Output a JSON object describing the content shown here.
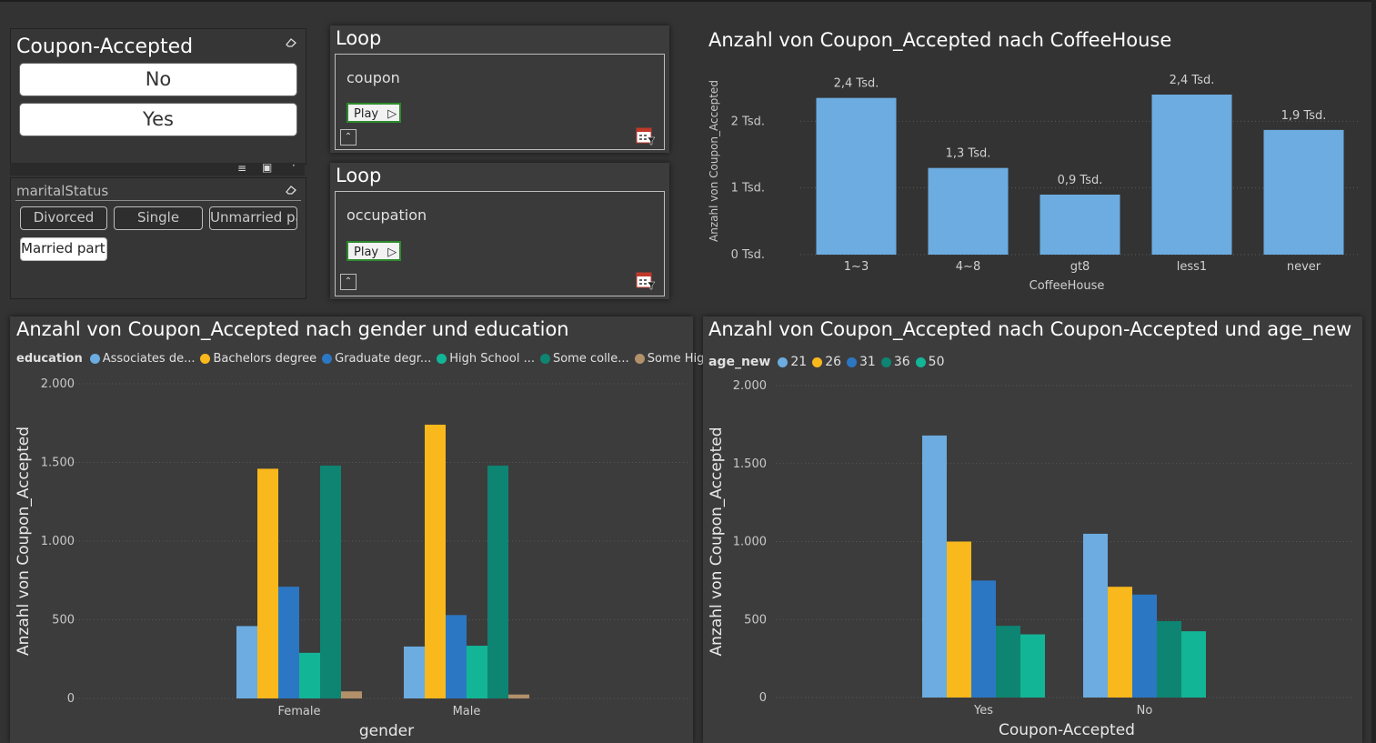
{
  "coupon_slicer": {
    "title": "Coupon-Accepted",
    "options": [
      "No",
      "Yes"
    ]
  },
  "marital_slicer": {
    "title": "maritalStatus",
    "options": [
      "Divorced",
      "Single",
      "Unmarried pa",
      "Married partn"
    ]
  },
  "loops": [
    {
      "title": "Loop",
      "field": "coupon",
      "play_label": "Play"
    },
    {
      "title": "Loop",
      "field": "occupation",
      "play_label": "Play"
    }
  ],
  "chart_data": [
    {
      "type": "bar",
      "title": "Anzahl von Coupon_Accepted nach CoffeeHouse",
      "xlabel": "CoffeeHouse",
      "ylabel": "Anzahl von Coupon_Accepted",
      "categories": [
        "1~3",
        "4~8",
        "gt8",
        "less1",
        "never"
      ],
      "values": [
        2.35,
        1.3,
        0.9,
        2.4,
        1.87
      ],
      "data_labels": [
        "2,4 Tsd.",
        "1,3 Tsd.",
        "0,9 Tsd.",
        "2,4 Tsd.",
        "1,9 Tsd."
      ],
      "yticks": [
        "0 Tsd.",
        "1 Tsd.",
        "2 Tsd."
      ],
      "ylim": [
        0,
        2.4
      ],
      "color": "#6cace0"
    },
    {
      "type": "bar",
      "title": "Anzahl von Coupon_Accepted nach gender und education",
      "xlabel": "gender",
      "ylabel": "Anzahl von Coupon_Accepted",
      "legend_title": "education",
      "categories": [
        "Female",
        "Male"
      ],
      "series": [
        {
          "name": "Associates de...",
          "color": "#6cace0",
          "values": [
            460,
            330
          ]
        },
        {
          "name": "Bachelors degree",
          "color": "#f9b81c",
          "values": [
            1460,
            1740
          ]
        },
        {
          "name": "Graduate degr...",
          "color": "#2c77c4",
          "values": [
            710,
            530
          ]
        },
        {
          "name": "High School ...",
          "color": "#13b597",
          "values": [
            290,
            335
          ]
        },
        {
          "name": "Some colle...",
          "color": "#0e8472",
          "values": [
            1480,
            1480
          ]
        },
        {
          "name": "Some High ...",
          "color": "#b2906a",
          "values": [
            45,
            25
          ]
        }
      ],
      "yticks": [
        "0",
        "500",
        "1.000",
        "1.500",
        "2.000"
      ],
      "ylim": [
        0,
        2000
      ]
    },
    {
      "type": "bar",
      "title": "Anzahl von Coupon_Accepted nach Coupon-Accepted und age_new",
      "xlabel": "Coupon-Accepted",
      "ylabel": "Anzahl von Coupon_Accepted",
      "legend_title": "age_new",
      "categories": [
        "Yes",
        "No"
      ],
      "series": [
        {
          "name": "21",
          "color": "#6cace0",
          "values": [
            1680,
            1050
          ]
        },
        {
          "name": "26",
          "color": "#f9b81c",
          "values": [
            1000,
            710
          ]
        },
        {
          "name": "31",
          "color": "#2c77c4",
          "values": [
            750,
            660
          ]
        },
        {
          "name": "36",
          "color": "#0e8472",
          "values": [
            460,
            490
          ]
        },
        {
          "name": "50",
          "color": "#13b597",
          "values": [
            405,
            425
          ]
        }
      ],
      "yticks": [
        "0",
        "500",
        "1.000",
        "1.500",
        "2.000"
      ],
      "ylim": [
        0,
        2000
      ]
    }
  ]
}
